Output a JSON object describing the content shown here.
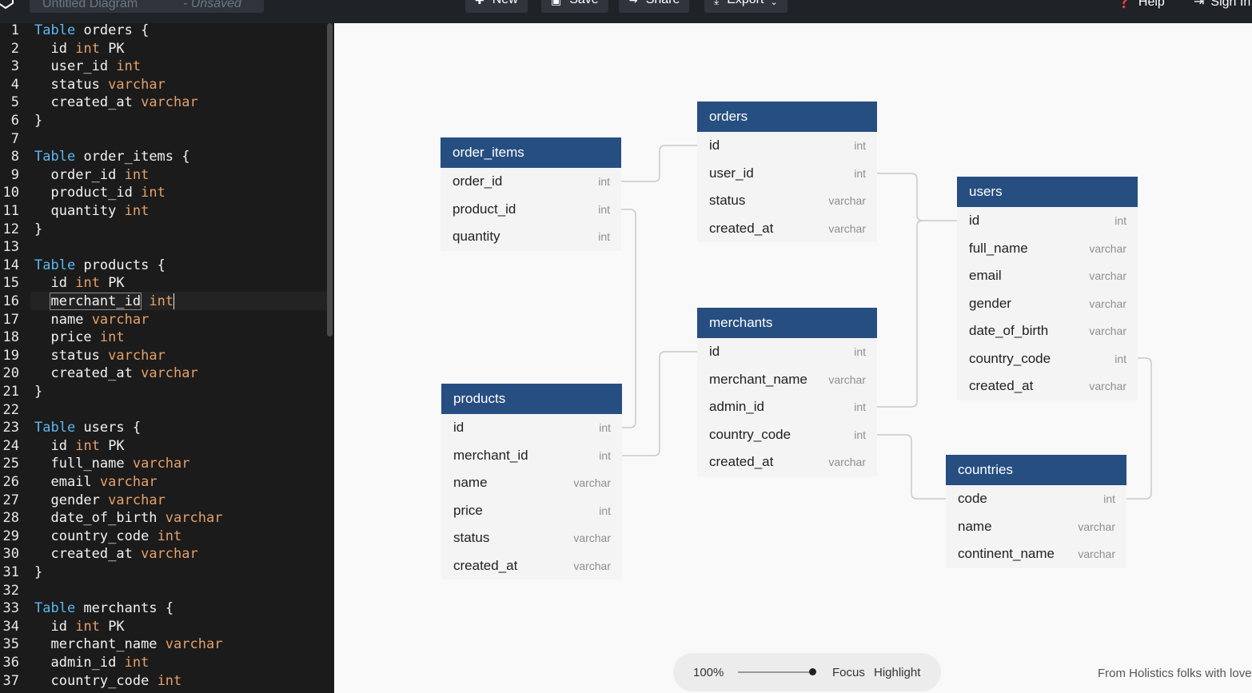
{
  "topbar": {
    "title": "Untitled Diagram",
    "unsaved": "- Unsaved",
    "buttons": {
      "new": "New",
      "save": "Save",
      "share": "Share",
      "export": "Export"
    },
    "links": {
      "help": "Help",
      "sign_in": "Sign In"
    }
  },
  "editor": {
    "lines": [
      "Table orders {",
      "  id int PK",
      "  user_id int",
      "  status varchar",
      "  created_at varchar",
      "}",
      "",
      "Table order_items {",
      "  order_id int",
      "  product_id int",
      "  quantity int",
      "}",
      "",
      "Table products {",
      "  id int PK",
      "  merchant_id int",
      "  name varchar",
      "  price int",
      "  status varchar",
      "  created_at varchar",
      "}",
      "",
      "Table users {",
      "  id int PK",
      "  full_name varchar",
      "  email varchar",
      "  gender varchar",
      "  date_of_birth varchar",
      "  country_code int",
      "  created_at varchar",
      "}",
      "",
      "Table merchants {",
      "  id int PK",
      "  merchant_name varchar",
      "  admin_id int",
      "  country_code int"
    ]
  },
  "diagram": {
    "tables": [
      {
        "name": "orders",
        "fields": [
          [
            "id",
            "int"
          ],
          [
            "user_id",
            "int"
          ],
          [
            "status",
            "varchar"
          ],
          [
            "created_at",
            "varchar"
          ]
        ]
      },
      {
        "name": "order_items",
        "fields": [
          [
            "order_id",
            "int"
          ],
          [
            "product_id",
            "int"
          ],
          [
            "quantity",
            "int"
          ]
        ]
      },
      {
        "name": "users",
        "fields": [
          [
            "id",
            "int"
          ],
          [
            "full_name",
            "varchar"
          ],
          [
            "email",
            "varchar"
          ],
          [
            "gender",
            "varchar"
          ],
          [
            "date_of_birth",
            "varchar"
          ],
          [
            "country_code",
            "int"
          ],
          [
            "created_at",
            "varchar"
          ]
        ]
      },
      {
        "name": "merchants",
        "fields": [
          [
            "id",
            "int"
          ],
          [
            "merchant_name",
            "varchar"
          ],
          [
            "admin_id",
            "int"
          ],
          [
            "country_code",
            "int"
          ],
          [
            "created_at",
            "varchar"
          ]
        ]
      },
      {
        "name": "products",
        "fields": [
          [
            "id",
            "int"
          ],
          [
            "merchant_id",
            "int"
          ],
          [
            "name",
            "varchar"
          ],
          [
            "price",
            "int"
          ],
          [
            "status",
            "varchar"
          ],
          [
            "created_at",
            "varchar"
          ]
        ]
      },
      {
        "name": "countries",
        "fields": [
          [
            "code",
            "int"
          ],
          [
            "name",
            "varchar"
          ],
          [
            "continent_name",
            "varchar"
          ]
        ]
      }
    ]
  },
  "zoom": {
    "level": "100%",
    "fraction": 1.0,
    "focus": "Focus",
    "highlight": "Highlight"
  },
  "footer": {
    "credit": "From Holistics folks with love"
  },
  "colors": {
    "table_header": "#264e81",
    "keyword": "#5bb8f0",
    "type": "#e6a06a",
    "topbar": "#1f2227"
  },
  "icons": {
    "new": "plus-icon",
    "save": "camera-icon",
    "share": "share-arrow-icon",
    "export": "download-icon",
    "help": "question-circle-icon",
    "sign_in": "sign-in-icon"
  }
}
